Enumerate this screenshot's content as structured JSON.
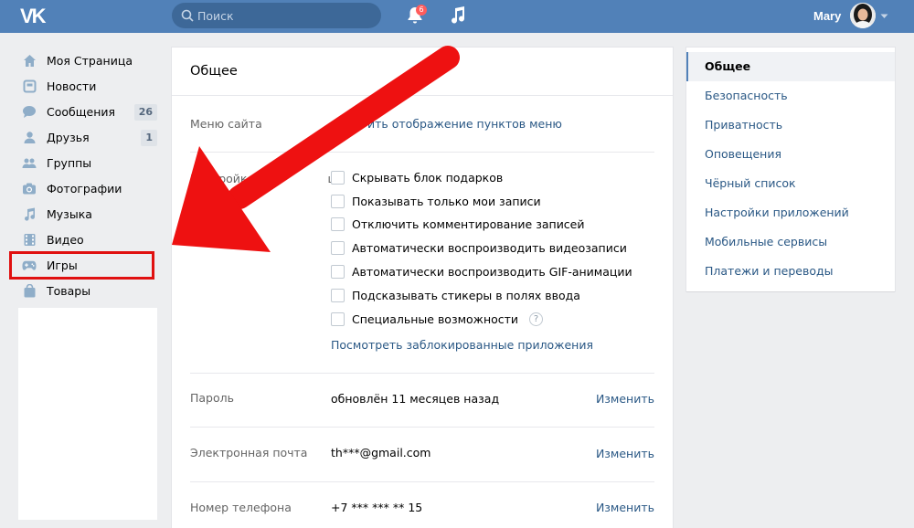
{
  "header": {
    "logo": "VK",
    "search_placeholder": "Поиск",
    "notifications_count": "6",
    "username": "Mary"
  },
  "sidebar": {
    "items": [
      {
        "label": "Моя Страница",
        "icon": "home-icon"
      },
      {
        "label": "Новости",
        "icon": "news-icon"
      },
      {
        "label": "Сообщения",
        "icon": "messages-icon",
        "count": "26"
      },
      {
        "label": "Друзья",
        "icon": "friends-icon",
        "count": "1"
      },
      {
        "label": "Группы",
        "icon": "groups-icon"
      },
      {
        "label": "Фотографии",
        "icon": "camera-icon"
      },
      {
        "label": "Музыка",
        "icon": "music-note-icon"
      },
      {
        "label": "Видео",
        "icon": "video-icon"
      },
      {
        "label": "Игры",
        "icon": "gamepad-icon"
      },
      {
        "label": "Товары",
        "icon": "bag-icon"
      }
    ]
  },
  "main": {
    "title": "Общее",
    "site_menu_label": "Меню сайта",
    "site_menu_link": "ить отображение пунктов меню",
    "page_settings_label": "Настройк",
    "page_settings_label_tail": "цы",
    "checkboxes": [
      "Скрывать блок подарков",
      "Показывать только мои записи",
      "Отключить комментирование записей",
      "Автоматически воспроизводить видеозаписи",
      "Автоматически воспроизводить GIF-анимации",
      "Подсказывать стикеры в полях ввода",
      "Специальные возможности"
    ],
    "help_glyph": "?",
    "blocked_apps_link": "Посмотреть заблокированные приложения",
    "password": {
      "label": "Пароль",
      "value": "обновлён 11 месяцев назад",
      "action": "Изменить"
    },
    "email": {
      "label": "Электронная почта",
      "value": "th***@gmail.com",
      "action": "Изменить"
    },
    "phone": {
      "label": "Номер телефона",
      "value": "+7 *** *** ** 15",
      "action": "Изменить"
    }
  },
  "right_menu": {
    "items": [
      {
        "label": "Общее",
        "active": true
      },
      {
        "label": "Безопасность"
      },
      {
        "label": "Приватность"
      },
      {
        "label": "Оповещения"
      },
      {
        "label": "Чёрный список"
      },
      {
        "label": "Настройки приложений"
      },
      {
        "label": "Мобильные сервисы"
      },
      {
        "label": "Платежи и переводы"
      }
    ]
  },
  "colors": {
    "header": "#5181b8",
    "link": "#2a5885",
    "highlight": "#e01010",
    "arrow": "#ee1111"
  }
}
